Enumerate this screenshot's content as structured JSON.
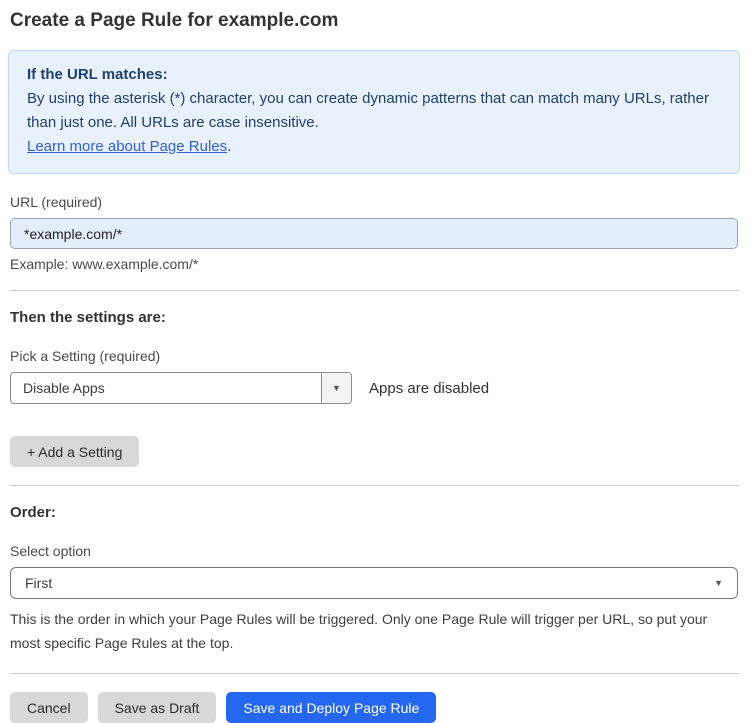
{
  "page": {
    "title": "Create a Page Rule for example.com"
  },
  "info_box": {
    "heading": "If the URL matches:",
    "body": "By using the asterisk (*) character, you can create dynamic patterns that can match many URLs, rather than just one. All URLs are case insensitive.",
    "link_label": "Learn more about Page Rules",
    "link_suffix": "."
  },
  "url_field": {
    "label": "URL (required)",
    "value": "*example.com/*",
    "helper": "Example: www.example.com/*"
  },
  "settings": {
    "heading": "Then the settings are:",
    "picker_label": "Pick a Setting (required)",
    "selected_setting": "Disable Apps",
    "status_text": "Apps are disabled",
    "add_button_label": "+ Add a Setting",
    "caret_icon": "▼"
  },
  "order": {
    "heading": "Order:",
    "select_label": "Select option",
    "selected_option": "First",
    "caret_icon": "▼",
    "helper": "This is the order in which your Page Rules will be triggered. Only one Page Rule will trigger per URL, so put your most specific Page Rules at the top."
  },
  "actions": {
    "cancel_label": "Cancel",
    "save_draft_label": "Save as Draft",
    "save_deploy_label": "Save and Deploy Page Rule"
  },
  "colors": {
    "info_background": "#e9f1fc",
    "info_border": "#bcd6f3",
    "info_text": "#1f3f6e",
    "link_blue": "#2f62d8",
    "url_input_background": "#e4eefb",
    "primary_button_blue": "#2667f0",
    "gray_button": "#d8d8d8"
  }
}
